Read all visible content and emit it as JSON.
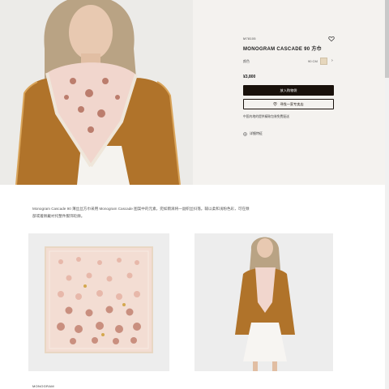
{
  "product": {
    "sku": "M78105",
    "title": "MONOGRAM CASCADE 90 方巾",
    "color_label": "颜色",
    "size_label": "90 CM",
    "price": "¥3,800",
    "add_to_bag": "放入购物袋",
    "find_store": "寻找一家专卖店",
    "shipping_note": "中国内地的提供精致包装免费配送",
    "details_toggle": "详细特征"
  },
  "description": "Monogram Cascade 90 薄丝丝方巾采用 Monogram Cascade 图案中的元素，宛如雨滴将一副织丝抖落。辅以柔和浅粉色彩，可在颈部或着佩戴衬托整件服饰轮廓。",
  "bottom": {
    "label": "MONOGRAM"
  },
  "colors": {
    "panel_bg": "#f4f2ef",
    "button_dark": "#19110b",
    "swatch": "#e6d7bd",
    "scarf_pink": "#f1d6cd",
    "jacket": "#b0732a"
  },
  "icons": [
    "heart-icon",
    "chevron-right-icon",
    "store-pin-icon",
    "plus-circle-icon"
  ]
}
